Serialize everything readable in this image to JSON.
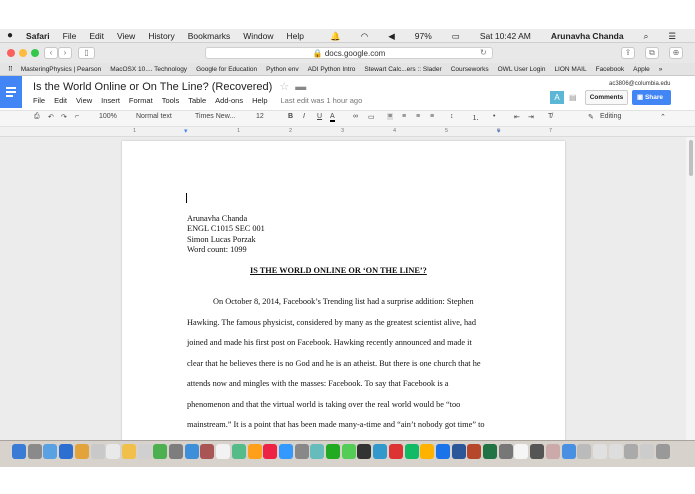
{
  "menubar": {
    "apple": "",
    "app": "Safari",
    "items": [
      "File",
      "Edit",
      "View",
      "History",
      "Bookmarks",
      "Window",
      "Help"
    ],
    "battery": "97%",
    "clock": "Sat 10:42 AM",
    "user": "Arunavha Chanda"
  },
  "browser": {
    "url": "docs.google.com"
  },
  "bookmarks": [
    "MasteringPhysics | Pearson",
    "MacOSX 10.... Technology",
    "Google for Education",
    "Python env",
    "ADI Python Intro",
    "Stewart Calc...ers :: Slader",
    "Courseworks",
    "OWL User Login",
    "LION MAIL",
    "Facebook",
    "Apple"
  ],
  "doc": {
    "title": "Is the World Online or On The Line? (Recovered)",
    "account": "ac3806@columbia.edu",
    "menu": [
      "File",
      "Edit",
      "View",
      "Insert",
      "Format",
      "Tools",
      "Table",
      "Add-ons",
      "Help"
    ],
    "last_edit": "Last edit was 1 hour ago",
    "comments_label": "Comments",
    "share_label": "Share",
    "avatar_letter": "A"
  },
  "toolbar": {
    "zoom": "100%",
    "style": "Normal text",
    "font": "Times New...",
    "size": "12",
    "bold": "B",
    "italic": "I",
    "underline": "U",
    "color": "A",
    "mode": "Editing"
  },
  "ruler": [
    "1",
    "1",
    "2",
    "3",
    "4",
    "5",
    "6",
    "7"
  ],
  "page": {
    "heading_lines": [
      "Arunavha Chanda",
      "ENGL C1015 SEC 001",
      "Simon Lucas Porzak",
      "Word count: 1099"
    ],
    "title": "IS THE WORLD ONLINE OR ‘ON THE LINE’?",
    "body_lines": [
      "On October 8, 2014, Facebook’s Trending list had a surprise addition: Stephen",
      "Hawking. The famous physicist, considered by many as the greatest scientist alive, had",
      "joined and made his first post on Facebook. Hawking recently announced and made it",
      "clear that he believes there is no God and he is an atheist. But there is one church that he",
      "attends now and mingles with the masses: Facebook. To say that Facebook is a",
      "phenomenon and that the virtual world is taking over the real world would be “too",
      "mainstream.” It is a point that has been made many-a-time and “ain’t nobody got time” to"
    ]
  },
  "colors": {
    "docs_blue": "#4285f4",
    "share_blue": "#4285f4",
    "avatar_teal": "#5bb7d5"
  }
}
